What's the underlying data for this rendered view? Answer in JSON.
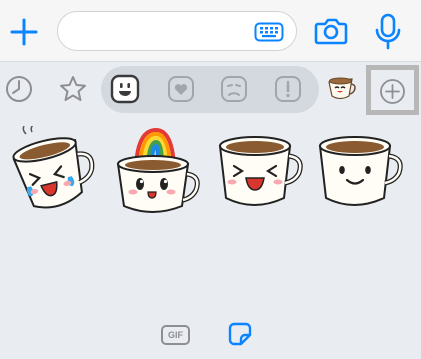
{
  "input_bar": {
    "icons": [
      "plus-icon",
      "keyboard-icon",
      "camera-icon",
      "microphone-icon"
    ],
    "accent_color": "#0a84ff"
  },
  "category_row": {
    "tabs": [
      "clock-icon",
      "star-icon",
      "smile-face-icon",
      "heart-icon",
      "sad-face-icon",
      "exclamation-icon",
      "coffee-pack-icon",
      "add-circle-icon"
    ],
    "selected_filter": "smile-face-icon"
  },
  "stickers": [
    "coffee-cup-laughing-tears",
    "coffee-cup-rainbow",
    "coffee-cup-laughing",
    "coffee-cup-smiling"
  ],
  "bottom_bar": {
    "gif_label": "GIF",
    "active_mode": "sticker-icon"
  }
}
